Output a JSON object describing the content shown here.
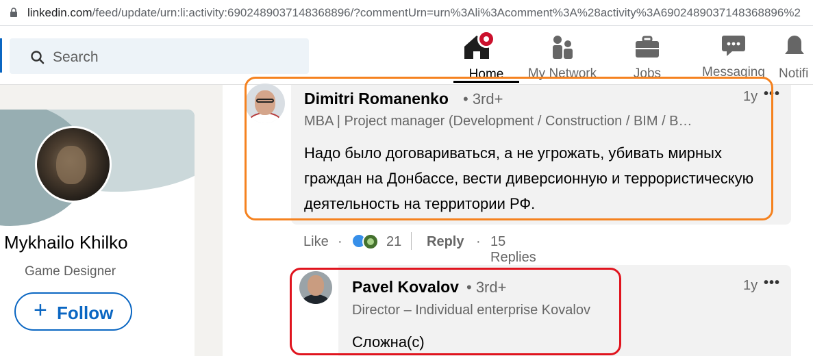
{
  "browser": {
    "url_host": "linkedin.com",
    "url_rest": "/feed/update/urn:li:activity:6902489037148368896/?commentUrn=urn%3Ali%3Acomment%3A%28activity%3A6902489037148368896%2"
  },
  "header": {
    "search_placeholder": "Search",
    "nav": [
      {
        "label": "Home",
        "icon": "home-icon",
        "active": true
      },
      {
        "label": "My Network",
        "icon": "people-icon"
      },
      {
        "label": "Jobs",
        "icon": "briefcase-icon"
      },
      {
        "label": "Messaging",
        "icon": "chat-icon"
      },
      {
        "label": "Notifi",
        "icon": "bell-icon"
      }
    ]
  },
  "profile": {
    "name": "Mykhailo Khilko",
    "title": "Game Designer",
    "follow_label": "Follow",
    "follow_icon": "plus-icon"
  },
  "comments": [
    {
      "author": "Dimitri Romanenko",
      "degree": "• 3rd+",
      "headline": "MBA | Project manager (Development / Construction / BIM / B…",
      "time": "1y",
      "more": "•••",
      "text": "Надо было договариваться, а не угрожать, убивать мирных граждан на Донбассе, вести диверсионную и террористическую деятельность на территории РФ.",
      "actions": {
        "like": "Like",
        "dot": "·",
        "reaction_count": "21",
        "reply": "Reply",
        "replies": "15 Replies"
      }
    },
    {
      "author": "Pavel Kovalov",
      "degree": "• 3rd+",
      "headline": "Director – Individual enterprise Kovalov",
      "time": "1y",
      "more": "•••",
      "text": "Сложна(с)"
    }
  ],
  "colors": {
    "highlight_orange": "#f5821f",
    "highlight_red": "#e0141e",
    "linkedin_blue": "#0a66c2",
    "notification_red": "#cb112d"
  }
}
